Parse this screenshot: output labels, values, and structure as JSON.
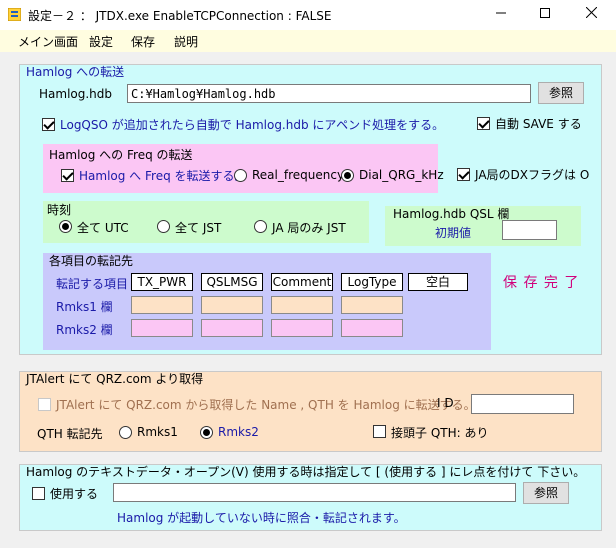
{
  "window": {
    "title": "設定－２ ： JTDX.exe EnableTCPConnection : FALSE",
    "minimize": "—",
    "maximize": "☐",
    "close": "✕"
  },
  "menu": [
    "メイン画面",
    "設定",
    "保存",
    "説明"
  ],
  "hamlog": {
    "title": "Hamlog への転送",
    "hdb_label": "Hamlog.hdb",
    "hdb_path": "C:¥Hamlog¥Hamlog.hdb",
    "browse": "参照",
    "logqso_label": "LogQSO が追加されたら自動で  Hamlog.hdb  にアペンド処理をする。",
    "auto_save_label": "自動 SAVE する",
    "freq": {
      "title": "Hamlog への Freq の転送",
      "transfer_label": "Hamlog へ Freq を転送する。",
      "real_freq": "Real_frequency",
      "dial_qrg": "Dial_QRG_kHz"
    },
    "ja_dx_flag": "JA局のDXフラグは O",
    "time": {
      "title": "時刻",
      "utc": "全て UTC",
      "jst": "全て JST",
      "ja_jst": "JA 局のみ JST"
    },
    "qsl": {
      "title": "Hamlog.hdb QSL 欄",
      "initial_label": "初期値",
      "initial_value": ""
    },
    "fields": {
      "title": "各項目の転記先",
      "row_transfer": "転記する項目",
      "row_rmks1": "Rmks1 欄",
      "row_rmks2": "Rmks2 欄",
      "items": [
        "TX_PWR",
        "QSLMSG",
        "Comment",
        "LogType",
        "空白"
      ]
    },
    "save_done": "保 存 完 了"
  },
  "jtalert": {
    "title": "JTAlert にて QRZ.com より取得",
    "transfer_label": "JTAlert にて QRZ.com から取得した Name , QTH を Hamlog に転送する。",
    "id_label": "I D",
    "id_value": "",
    "qth_label": "QTH 転記先",
    "rmks1": "Rmks1",
    "rmks2": "Rmks2",
    "prefix_label": "接頭子  QTH: あり"
  },
  "textdata": {
    "title": "Hamlog のテキストデータ・オープン(V)     使用する時は指定して  [ (使用する ] にレ点を付けて  下さい。",
    "use_label": "使用する",
    "path_value": "",
    "browse": "参照",
    "note": "Hamlog が起動していない時に照合・転記されます。"
  },
  "colors": {
    "cyan_panel": "#cdfbfb",
    "pink_panel": "#fbc6f4",
    "green_panel": "#cdfbcd",
    "lavender_panel": "#c9c9fb",
    "peach_panel": "#fde2c6",
    "pink_cell": "#fbc6f4",
    "peach_cell": "#fde2c6",
    "save_done": "#d0007b",
    "label_blue": "#1a1aa8"
  }
}
